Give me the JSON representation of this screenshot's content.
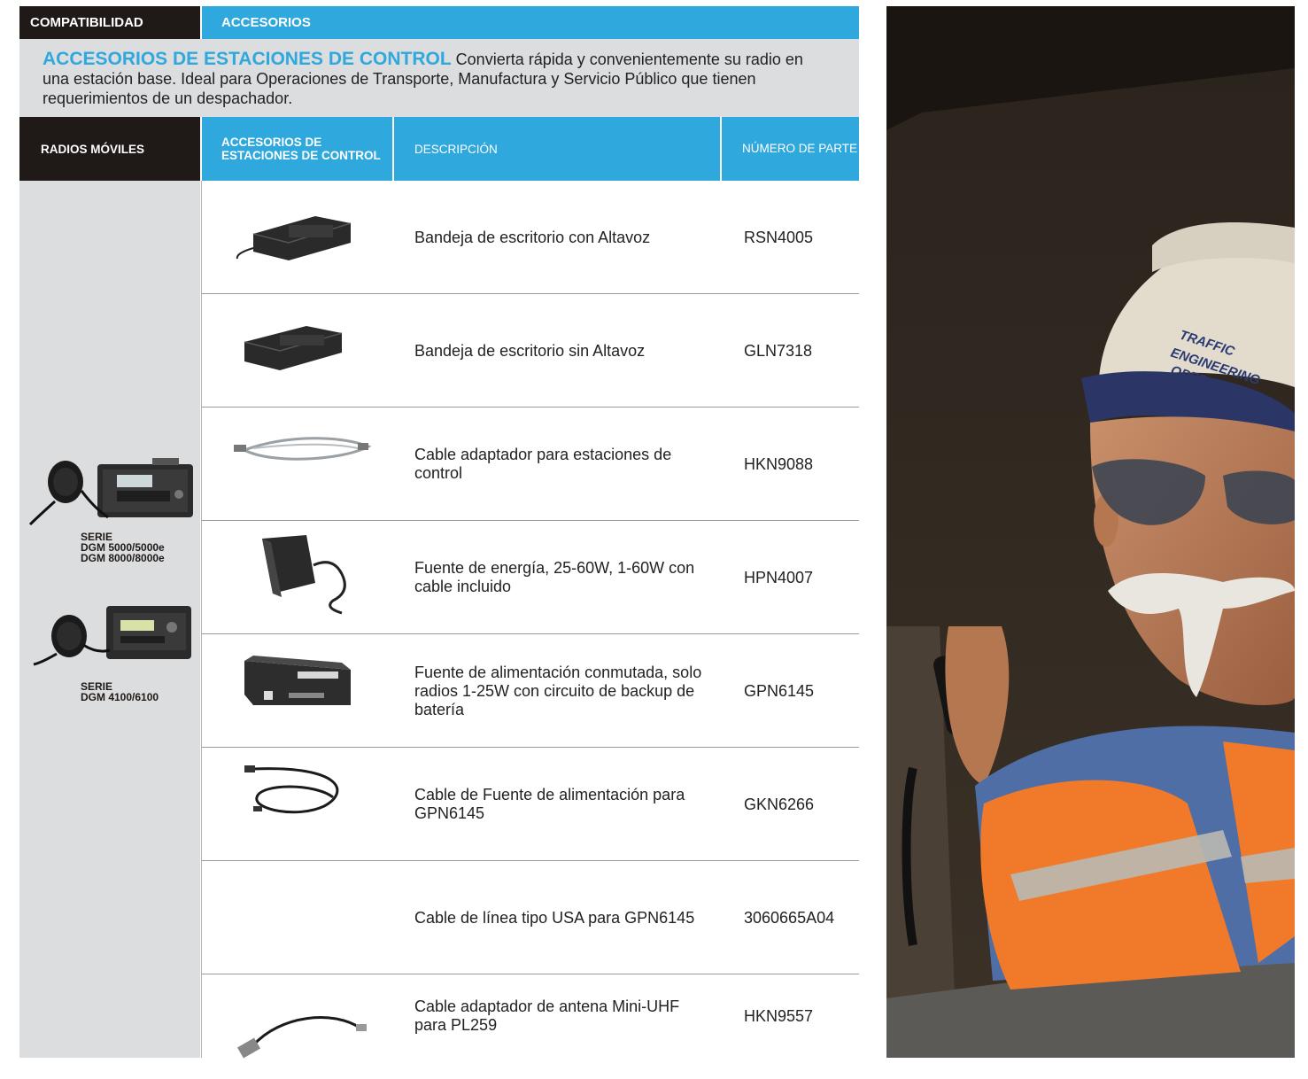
{
  "tabs": {
    "compat": "COMPATIBILIDAD",
    "accessories": "ACCESORIOS"
  },
  "intro": {
    "title": "ACCESORIOS DE ESTACIONES DE CONTROL",
    "text": "Convierta rápida y convenientemente su radio en una estación base. Ideal para Operaciones de Transporte, Manufactura y Servicio Público que tienen requerimientos de un despachador."
  },
  "table_headers": {
    "radios": "RADIOS MÓVILES",
    "accessories": "ACCESORIOS DE ESTACIONES DE CONTROL",
    "description": "DESCRIPCIÓN",
    "part_number": "NÚMERO DE PARTE"
  },
  "radios": [
    {
      "label": "SERIE\nDGM 5000/5000e\nDGM 8000/8000e"
    },
    {
      "label": "SERIE\nDGM 4100/6100"
    }
  ],
  "rows": [
    {
      "description": "Bandeja de escritorio con Altavoz",
      "part": "RSN4005",
      "image": "desk-tray-with-speaker"
    },
    {
      "description": "Bandeja de escritorio sin Altavoz",
      "part": "GLN7318",
      "image": "desk-tray"
    },
    {
      "description": "Cable adaptador para estaciones de control",
      "part": "HKN9088",
      "image": "coax-cable"
    },
    {
      "description": "Fuente de energía, 25-60W, 1-60W con cable incluido",
      "part": "HPN4007",
      "image": "power-supply"
    },
    {
      "description": "Fuente de alimentación conmutada, solo radios 1-25W con circuito de backup de batería",
      "part": "GPN6145",
      "image": "switching-power-supply"
    },
    {
      "description": "Cable de Fuente de alimentación para GPN6145",
      "part": "GKN6266",
      "image": "power-cable"
    },
    {
      "description": "Cable de línea tipo USA para GPN6145",
      "part": "3060665A04",
      "image": ""
    },
    {
      "description": "Cable adaptador de antena Mini-UHF para PL259",
      "part": "HKN9557",
      "image": "antenna-adapter-cable"
    }
  ],
  "photo": {
    "cap_text": "TRAFFIC\nENGINEERING\nOPERATIONS"
  },
  "colors": {
    "accent": "#2ea8dd",
    "dark": "#1f1a17",
    "band": "#dcdddf",
    "vest": "#f07a2a"
  }
}
